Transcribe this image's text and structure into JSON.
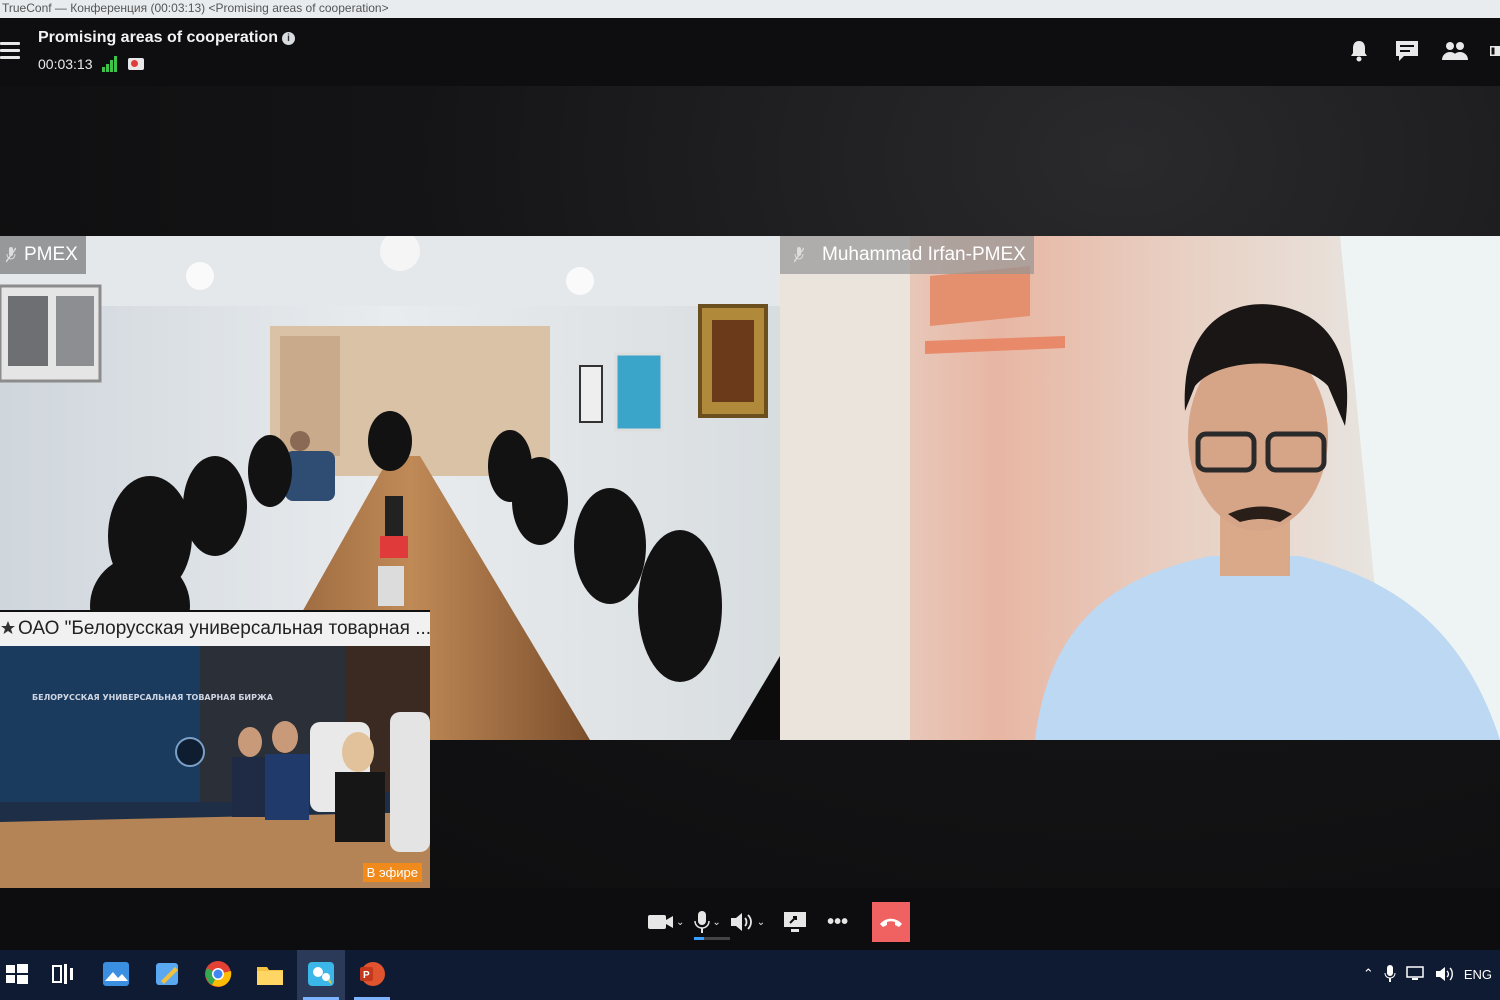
{
  "window": {
    "title": "TrueConf — Конференция (00:03:13) <Promising areas of cooperation>"
  },
  "conference": {
    "title": "Promising areas of cooperation",
    "timer": "00:03:13",
    "accent": "#3ec34a",
    "rec_color": "#e23b3b"
  },
  "top_icons": [
    "bell-icon",
    "chat-icon",
    "participants-icon",
    "layout-icon"
  ],
  "participants": [
    {
      "name": "PMEX",
      "mic": "muted"
    },
    {
      "name": "Muhammad Irfan-PMEX",
      "mic": "muted"
    },
    {
      "name": "ОАО \"Белорусская универсальная товарная ...",
      "badge": "В эфире",
      "sign_text": "БЕЛОРУССКАЯ УНИВЕРСАЛЬНАЯ ТОВАРНАЯ БИРЖА"
    }
  ],
  "controls": {
    "items": [
      "camera-icon",
      "microphone-icon",
      "speaker-icon",
      "screen-share-icon",
      "more-icon",
      "hangup-icon"
    ],
    "hangup_color": "#f06262",
    "more_label": "•••"
  },
  "taskbar": {
    "apps": [
      "windows-start-icon",
      "task-view-icon",
      "photos-app-icon",
      "paint-app-icon",
      "chrome-icon",
      "file-explorer-icon",
      "trueconf-icon",
      "powerpoint-icon"
    ],
    "language": "ENG",
    "color": "#0f1a33"
  }
}
